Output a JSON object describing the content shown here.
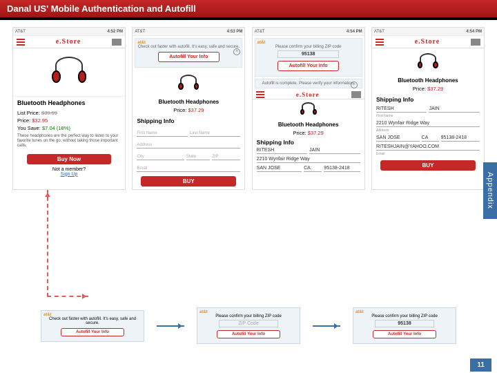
{
  "slide": {
    "title": "Danal US' Mobile Authentication and Autofill",
    "appendix": "Appendix",
    "page": "11"
  },
  "statusbar": {
    "carrier": "AT&T",
    "t1": "4:52 PM",
    "t2": "4:53 PM",
    "t3": "4:54 PM",
    "t4": "4:54 PM",
    "signal": "📶 14% 🔋"
  },
  "store": {
    "logo": "e.Store",
    "product": "Bluetooth Headphones",
    "list_label": "List Price:",
    "list": "$39.99",
    "price_label": "Price:",
    "price2": "$32.95",
    "price3": "$37.29",
    "save_label": "You Save:",
    "save": "$7.04 (18%)",
    "desc": "These headphones are the perfect way to listen to your favorite tunes on the go, without taking those important calls.",
    "buy": "Buy Now",
    "buy2": "BUY",
    "signup_q": "Not a member?",
    "signup": "Sign Up"
  },
  "prompt": {
    "att": "at&t",
    "line": "Check out faster with autofill. It's easy, safe and secure.",
    "verify": "Please confirm your billing ZIP code",
    "complete": "Autofill is complete. Please verify your information.",
    "btn": "Autofill Your Info",
    "zip_ph": "ZIP Code",
    "zip_val": "95138"
  },
  "ship": {
    "h": "Shipping Info",
    "first_ph": "First Name",
    "last_ph": "Last Name",
    "addr_ph": "Address",
    "city_ph": "City",
    "state_ph": "State",
    "zip_ph": "ZIP",
    "email_ph": "Email",
    "first": "RITESH",
    "last": "JAIN",
    "addr": "2210 Wynfair Ridge Way",
    "city": "SAN JOSE",
    "state": "CA",
    "zip": "95138-2418",
    "email": "RITESHJAIN@YAHOO.COM"
  }
}
